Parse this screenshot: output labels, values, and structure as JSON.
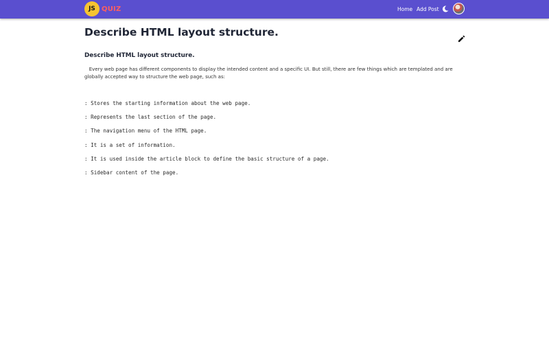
{
  "navbar": {
    "logo_badge": "JS",
    "logo_text": "QUIZ",
    "home_label": "Home",
    "add_post_label": "Add Post",
    "theme_icon": "moon-icon",
    "avatar_icon": "user-avatar"
  },
  "post": {
    "title": "Describe HTML layout structure.",
    "edit_icon": "pencil-icon",
    "subtitle": "Describe HTML layout structure.",
    "paragraph": "Every web page has different components to display the intended content and a specific UI. But still, there are few things which are templated and are globally accepted way to structure the web page, such as:",
    "items": [
      ": Stores the starting information about the web page.",
      ": Represents the last section of the page.",
      ": The navigation menu of the HTML page.",
      ": It is a set of information.",
      ": It is used inside the article block to define the basic structure of a page.",
      ": Sidebar content of the page."
    ]
  },
  "colors": {
    "navbar_bg": "#5a4fcf",
    "logo_badge_bg": "#f6c431",
    "logo_text": "#ff5f5f"
  }
}
